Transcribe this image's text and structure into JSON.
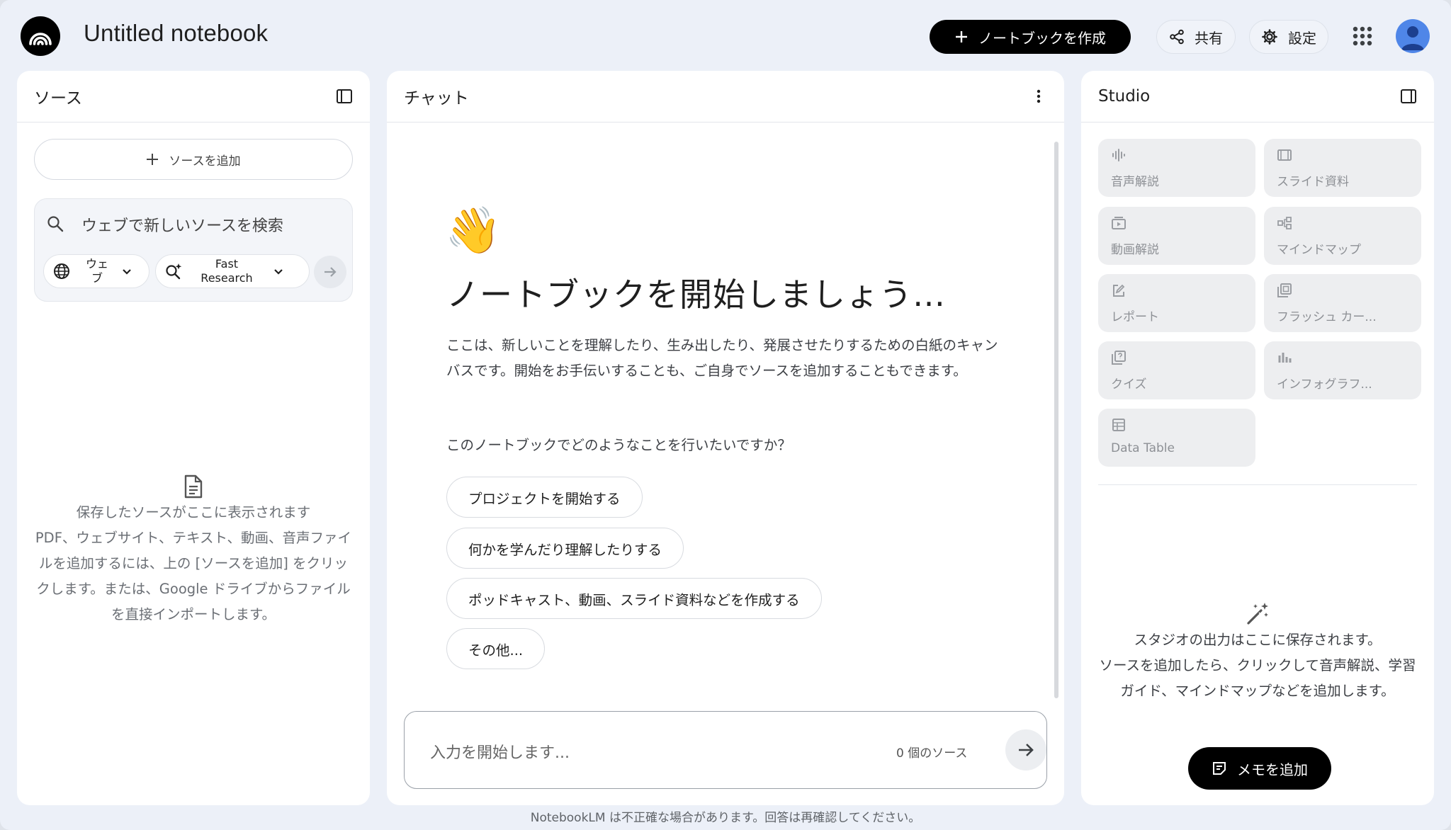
{
  "header": {
    "title": "Untitled notebook",
    "create_label": "ノートブックを作成",
    "share_label": "共有",
    "settings_label": "設定"
  },
  "sources": {
    "title": "ソース",
    "add_label": "ソースを追加",
    "search_placeholder": "ウェブで新しいソースを検索",
    "web_label": "ウェブ",
    "web_label_line1": "ウェ",
    "web_label_line2": "ブ",
    "fast_line1": "Fast",
    "fast_line2": "Research",
    "empty_title": "保存したソースがここに表示されます",
    "empty_body": "PDF、ウェブサイト、テキスト、動画、音声ファイルを追加するには、上の [ソースを追加] をクリックします。または、Google ドライブからファイルを直接インポートします。"
  },
  "chat": {
    "title": "チャット",
    "emoji": "👋",
    "heading": "ノートブックを開始しましょう…",
    "description": "ここは、新しいことを理解したり、生み出したり、発展させたりするための白紙のキャンバスです。開始をお手伝いすることも、ご自身でソースを追加することもできます。",
    "question": "このノートブックでどのようなことを行いたいですか？",
    "suggestions": [
      "プロジェクトを開始する",
      "何かを学んだり理解したりする",
      "ポッドキャスト、動画、スライド資料などを作成する",
      "その他..."
    ],
    "input_placeholder": "入力を開始します...",
    "source_count": "0 個のソース"
  },
  "studio": {
    "title": "Studio",
    "tiles": [
      {
        "label": "音声解説",
        "icon": "audio-wave-icon"
      },
      {
        "label": "スライド資料",
        "icon": "slides-icon"
      },
      {
        "label": "動画解説",
        "icon": "video-icon"
      },
      {
        "label": "マインドマップ",
        "icon": "mindmap-icon"
      },
      {
        "label": "レポート",
        "icon": "report-icon"
      },
      {
        "label": "フラッシュ カー...",
        "icon": "flashcard-icon"
      },
      {
        "label": "クイズ",
        "icon": "quiz-icon"
      },
      {
        "label": "インフォグラフ...",
        "icon": "infographic-icon"
      },
      {
        "label": "Data Table",
        "icon": "table-icon"
      }
    ],
    "empty_title": "スタジオの出力はここに保存されます。",
    "empty_body": "ソースを追加したら、クリックして音声解説、学習ガイド、マインドマップなどを追加します。",
    "memo_label": "メモを追加"
  },
  "footer": "NotebookLM は不正確な場合があります。回答は再確認してください。"
}
